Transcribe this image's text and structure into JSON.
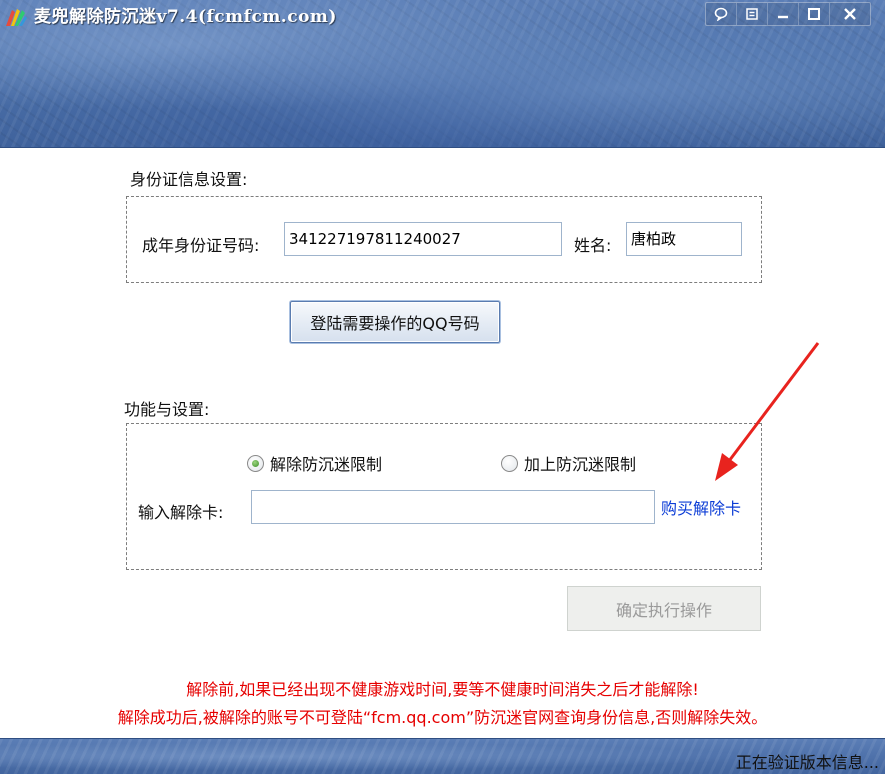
{
  "window": {
    "title": "麦兜解除防沉迷v7.4(fcmfcm.com)",
    "controls": [
      "chat-icon",
      "menu-icon",
      "minimize-icon",
      "maximize-icon",
      "close-icon"
    ]
  },
  "identity": {
    "section_title": "身份证信息设置:",
    "id_label": "成年身份证号码:",
    "id_value": "341227197811240027",
    "name_label": "姓名:",
    "name_value": "唐柏政",
    "login_button": "登陆需要操作的QQ号码"
  },
  "functions": {
    "section_title": "功能与设置:",
    "radio_options": [
      {
        "label": "解除防沉迷限制",
        "selected": true
      },
      {
        "label": "加上防沉迷限制",
        "selected": false
      }
    ],
    "card_label": "输入解除卡:",
    "card_value": "",
    "buy_link": "购买解除卡",
    "confirm_button": "确定执行操作"
  },
  "warnings": [
    "解除前,如果已经出现不健康游戏时间,要等不健康时间消失之后才能解除!",
    "解除成功后,被解除的账号不可登陆“fcm.qq.com”防沉迷官网查询身份信息,否则解除失效。"
  ],
  "status": {
    "text": "正在验证版本信息..."
  },
  "colors": {
    "header_blue": "#4f74ad",
    "warning_red": "#e60000",
    "link_blue": "#0b3cd6",
    "arrow_red": "#e8231e",
    "radio_green": "#3d8f2a"
  }
}
